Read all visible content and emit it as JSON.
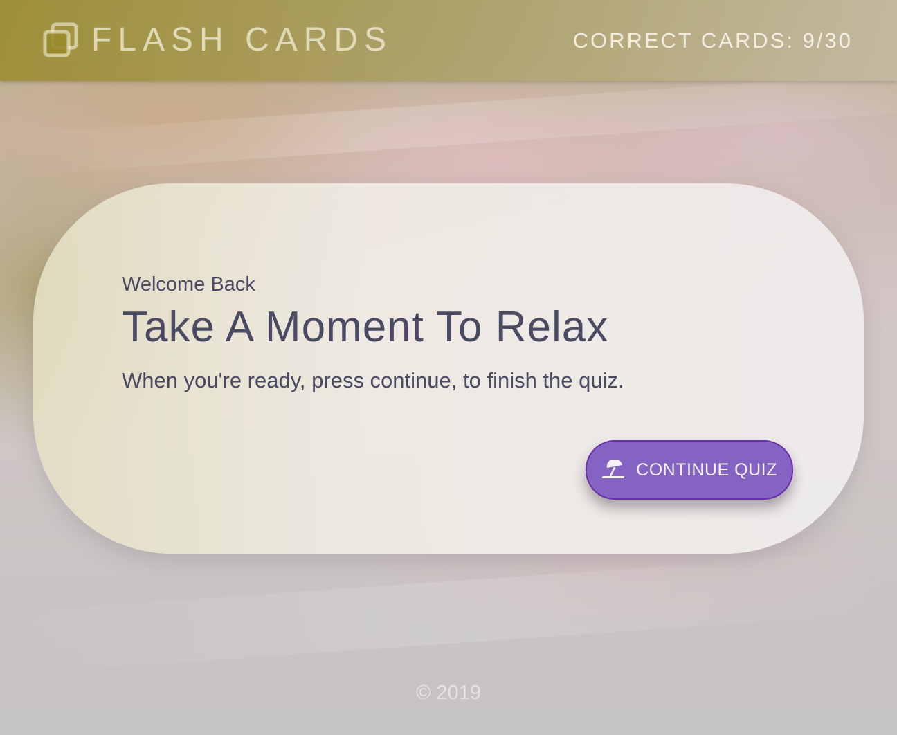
{
  "header": {
    "icon": "flash-cards-icon",
    "title": "FLASH CARDS",
    "counter": "CORRECT CARDS: 9/30"
  },
  "card": {
    "greeting": "Welcome Back",
    "title": "Take A Moment To Relax",
    "message": "When you're ready, press continue, to finish the quiz.",
    "button": {
      "icon": "beach-umbrella-icon",
      "label": "CONTINUE QUIZ"
    }
  },
  "footer": {
    "copyright": "© 2019"
  },
  "colors": {
    "button": "#8463c3",
    "text": "#4b4a63"
  }
}
